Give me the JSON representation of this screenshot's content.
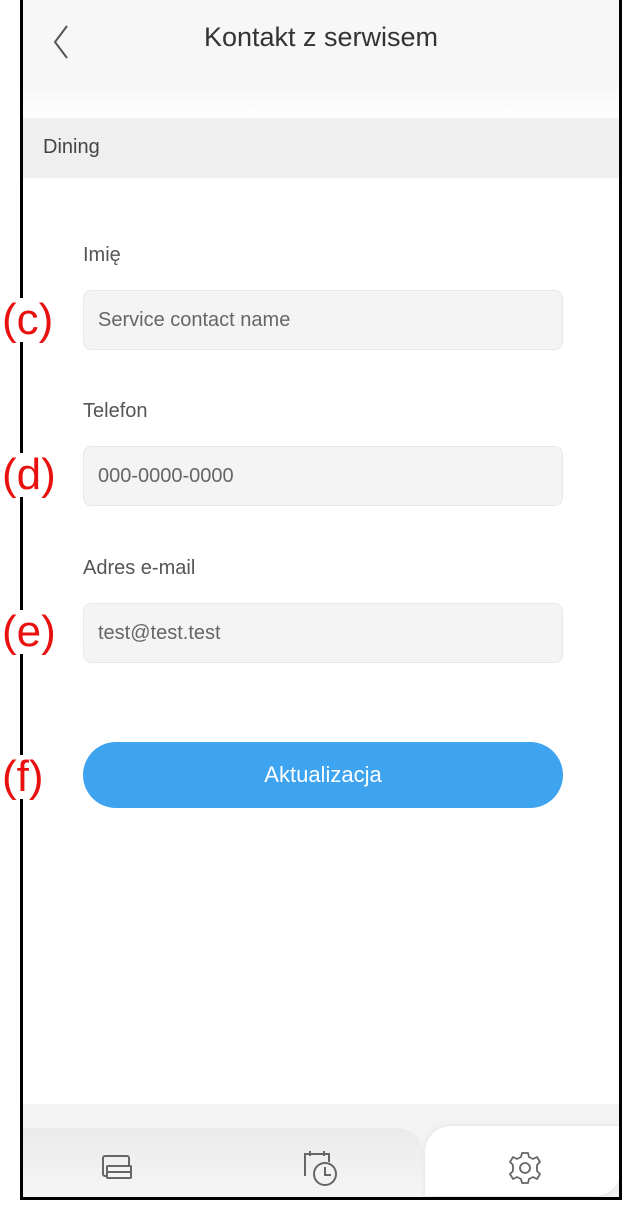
{
  "header": {
    "title": "Kontakt z serwisem",
    "back_icon": "chevron-left-icon"
  },
  "section": {
    "label": "Dining"
  },
  "form": {
    "name": {
      "label": "Imię",
      "placeholder": "Service contact name"
    },
    "phone": {
      "label": "Telefon",
      "placeholder": "000-0000-0000"
    },
    "email": {
      "label": "Adres e-mail",
      "placeholder": "test@test.test"
    },
    "submit_label": "Aktualizacja"
  },
  "markers": {
    "c": "(c)",
    "d": "(d)",
    "e": "(e)",
    "f": "(f)"
  },
  "bottom_nav": {
    "items": [
      {
        "icon": "printer-icon",
        "active": false
      },
      {
        "icon": "calendar-clock-icon",
        "active": false
      },
      {
        "icon": "gear-icon",
        "active": true
      }
    ]
  },
  "colors": {
    "accent": "#3fa4f0",
    "marker": "#e8110f"
  }
}
